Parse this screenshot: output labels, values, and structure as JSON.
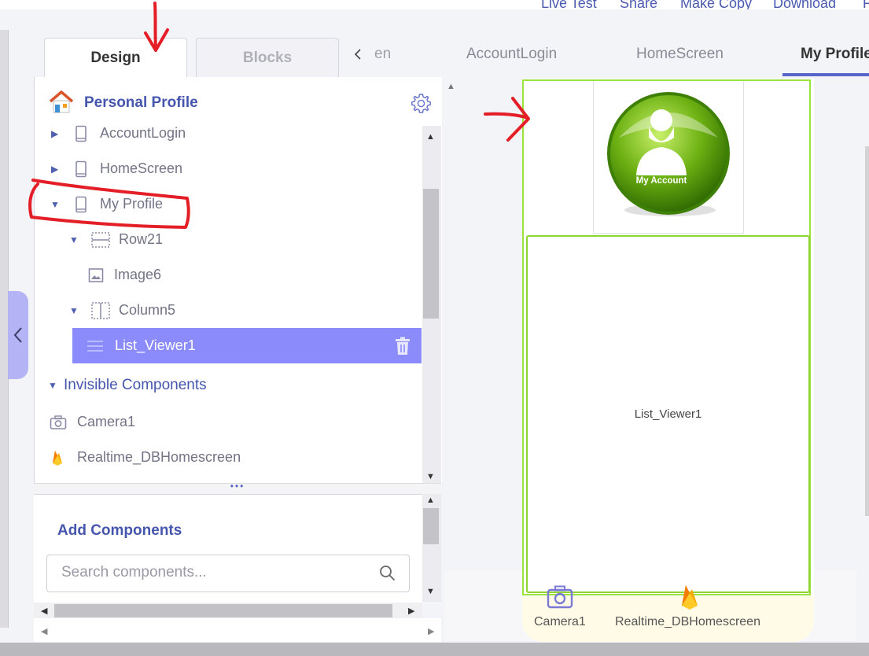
{
  "top_menu": [
    "Live Test",
    "Share",
    "Make Copy",
    "Download",
    "F"
  ],
  "tabs": {
    "design": "Design",
    "blocks": "Blocks"
  },
  "screen_tabs": {
    "partial": "en",
    "items": [
      "AccountLogin",
      "HomeScreen"
    ],
    "active": "My Profile"
  },
  "tree": {
    "project_title": "Personal Profile",
    "nodes": [
      "AccountLogin",
      "HomeScreen",
      "My Profile",
      "Row21",
      "Image6",
      "Column5",
      "List_Viewer1"
    ],
    "invisible_header": "Invisible Components",
    "invisible": [
      "Camera1",
      "Realtime_DBHomescreen"
    ]
  },
  "add_components": {
    "title": "Add Components",
    "search_placeholder": "Search components..."
  },
  "viewer": {
    "image_caption": "My Account",
    "list_viewer_label": "List_Viewer1",
    "nonvisible": [
      "Camera1",
      "Realtime_DBHomescreen"
    ]
  },
  "colors": {
    "accent": "#5865c8",
    "selected": "#8b8bfb",
    "frame_green": "#9be23c",
    "annotation_red": "#e41e26"
  }
}
